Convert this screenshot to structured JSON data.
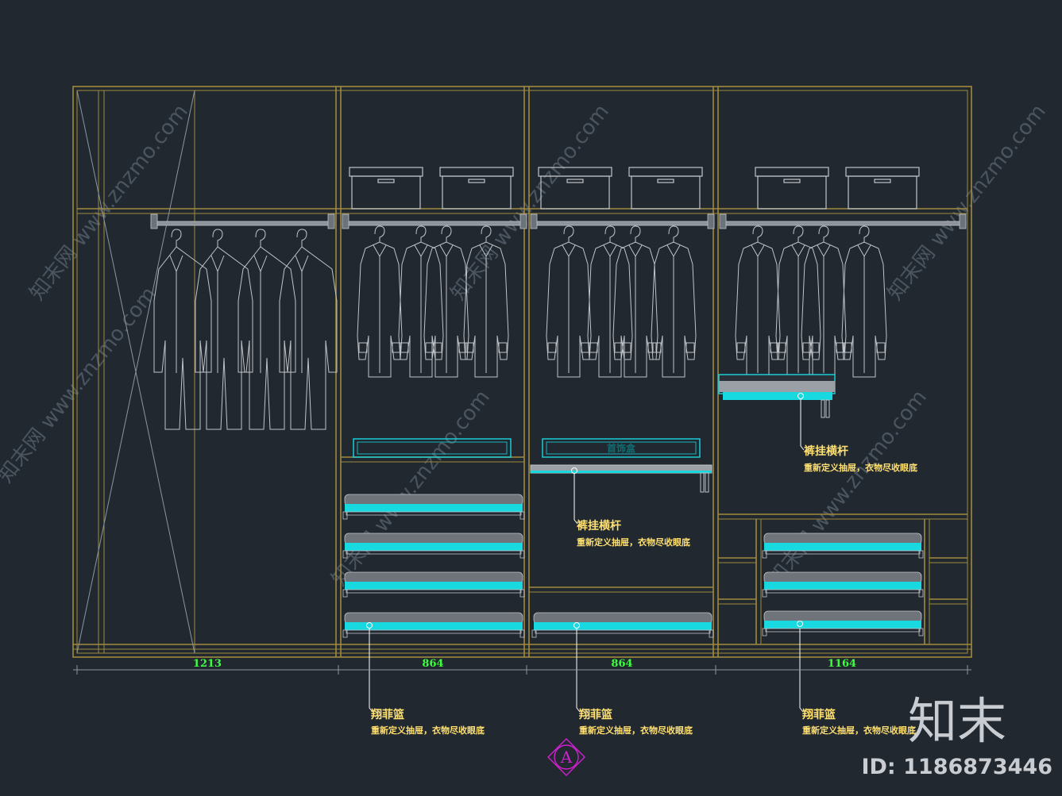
{
  "colors": {
    "background": "#212830",
    "frame": "#a08a3c",
    "clothes": "#c0c4c8",
    "accessory": "#18d8e0",
    "dimension_text": "#3dff3d",
    "annotation_text": "#ffe070",
    "marker": "#d020d0"
  },
  "dimensions": [
    "1213",
    "864",
    "864",
    "1164"
  ],
  "boxes": {
    "jewelry_tray_label": "首饰盒"
  },
  "notes": {
    "pants_rack_1": {
      "title": "裤挂横杆",
      "subtitle": "重新定义抽屉，衣物尽收眼底"
    },
    "pants_rack_2": {
      "title": "裤挂横杆",
      "subtitle": "重新定义抽屉，衣物尽收眼底"
    },
    "basket_1": {
      "title": "翔菲篮",
      "subtitle": "重新定义抽屉，衣物尽收眼底"
    },
    "basket_2": {
      "title": "翔菲篮",
      "subtitle": "重新定义抽屉，衣物尽收眼底"
    },
    "basket_3": {
      "title": "翔菲篮",
      "subtitle": "重新定义抽屉，衣物尽收眼底"
    }
  },
  "section_marker": "A",
  "watermark": {
    "text": "知末网 www.znzmo.com",
    "brand": "知末",
    "id": "ID: 1186873446"
  }
}
